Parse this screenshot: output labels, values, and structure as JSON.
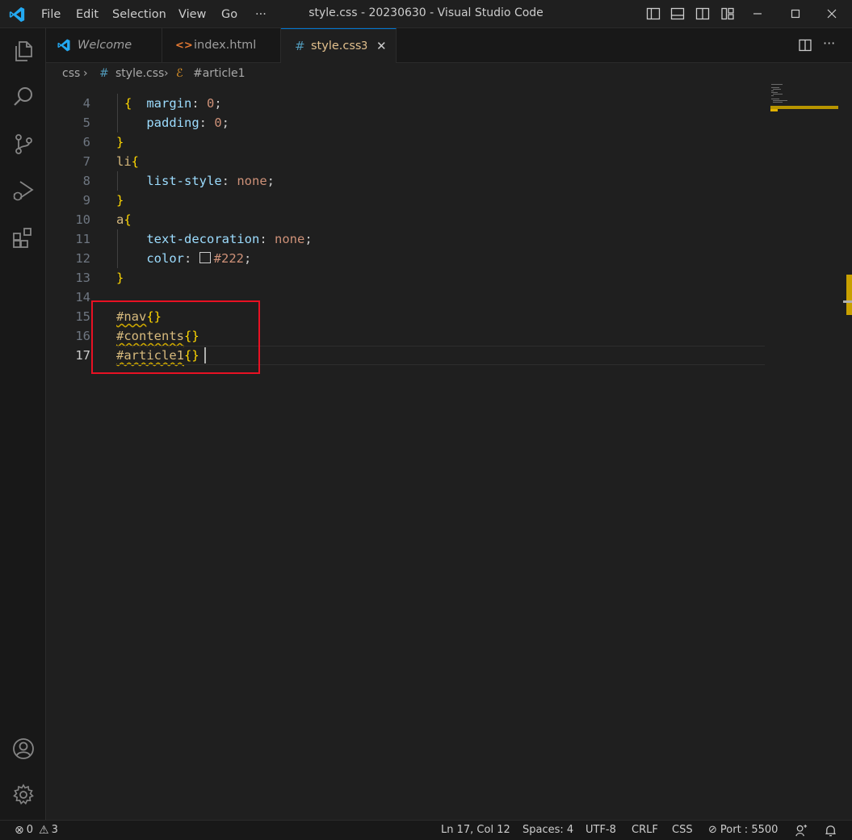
{
  "app": {
    "window_title": "style.css - 20230630 - Visual Studio Code"
  },
  "menu": {
    "items": [
      "File",
      "Edit",
      "Selection",
      "View",
      "Go",
      "···"
    ]
  },
  "tabs": [
    {
      "label": "Welcome",
      "icon": "vscode-icon"
    },
    {
      "label": "index.html",
      "icon": "html-icon"
    },
    {
      "label": "style.css",
      "icon": "css-hash-icon",
      "badge": "3",
      "close": "✕"
    }
  ],
  "breadcrumb": {
    "folder": "css",
    "file": "style.css",
    "file_icon": "#",
    "symbol": "#article1",
    "separator": "›"
  },
  "editor": {
    "lines": [
      {
        "num": "4",
        "tokens": [
          [
            "indent",
            "    "
          ],
          [
            "prop",
            "margin"
          ],
          [
            "punc",
            ": "
          ],
          [
            "val",
            "0"
          ],
          [
            "punc",
            ";"
          ]
        ]
      },
      {
        "num": "5",
        "tokens": [
          [
            "indent",
            "    "
          ],
          [
            "prop",
            "padding"
          ],
          [
            "punc",
            ": "
          ],
          [
            "val",
            "0"
          ],
          [
            "punc",
            ";"
          ]
        ]
      },
      {
        "num": "6",
        "tokens": [
          [
            "brace",
            "}"
          ]
        ]
      },
      {
        "num": "7",
        "tokens": [
          [
            "sel",
            "li"
          ],
          [
            "brace",
            "{"
          ]
        ]
      },
      {
        "num": "8",
        "tokens": [
          [
            "indent",
            "    "
          ],
          [
            "prop",
            "list-style"
          ],
          [
            "punc",
            ": "
          ],
          [
            "val",
            "none"
          ],
          [
            "punc",
            ";"
          ]
        ]
      },
      {
        "num": "9",
        "tokens": [
          [
            "brace",
            "}"
          ]
        ]
      },
      {
        "num": "10",
        "tokens": [
          [
            "sel",
            "a"
          ],
          [
            "brace",
            "{"
          ]
        ]
      },
      {
        "num": "11",
        "tokens": [
          [
            "indent",
            "    "
          ],
          [
            "prop",
            "text-decoration"
          ],
          [
            "punc",
            ": "
          ],
          [
            "val",
            "none"
          ],
          [
            "punc",
            ";"
          ]
        ]
      },
      {
        "num": "12",
        "tokens": [
          [
            "indent",
            "    "
          ],
          [
            "prop",
            "color"
          ],
          [
            "punc",
            ": "
          ],
          [
            "swatch",
            ""
          ],
          [
            "hex",
            "#222"
          ],
          [
            "punc",
            ";"
          ]
        ]
      },
      {
        "num": "13",
        "tokens": [
          [
            "brace",
            "}"
          ]
        ]
      },
      {
        "num": "14",
        "tokens": []
      },
      {
        "num": "15",
        "tokens": [
          [
            "sel squig",
            "#nav"
          ],
          [
            "brace",
            "{}"
          ]
        ]
      },
      {
        "num": "16",
        "tokens": [
          [
            "sel squig",
            "#contents"
          ],
          [
            "brace",
            "{}"
          ]
        ]
      },
      {
        "num": "17",
        "tokens": [
          [
            "sel squig",
            "#article1"
          ],
          [
            "brace",
            "{}"
          ]
        ]
      }
    ],
    "partial_top_line": "{",
    "current_line": "17",
    "swatch_color": "#222222"
  },
  "status": {
    "errors": "0",
    "warnings": "3",
    "position": "Ln 17, Col 12",
    "spaces": "Spaces: 4",
    "encoding": "UTF-8",
    "eol": "CRLF",
    "language": "CSS",
    "port": "Port : 5500"
  },
  "colors": {
    "accent": "#0078d4",
    "highlight_box": "#e81123",
    "warning": "#cca700"
  }
}
